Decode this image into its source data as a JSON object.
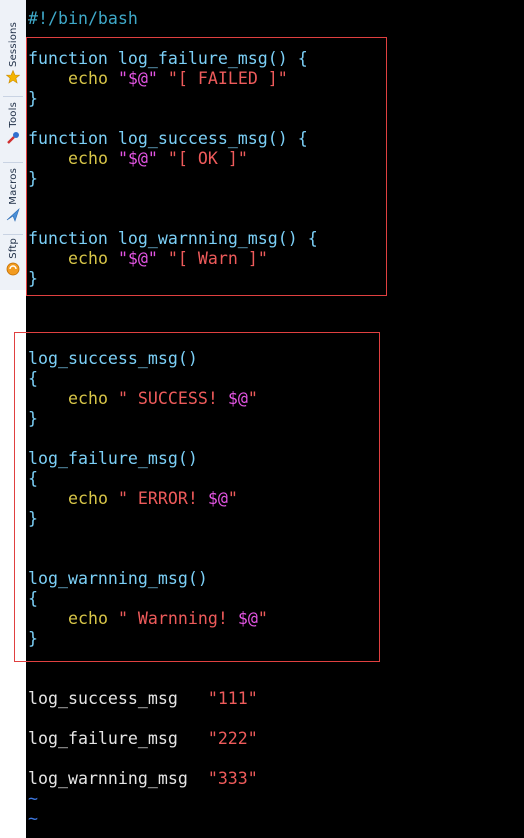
{
  "sidebar": {
    "tabs": [
      {
        "label": "Sessions",
        "icon": "sessions-icon"
      },
      {
        "label": "Tools",
        "icon": "star-icon"
      },
      {
        "label": "Macros",
        "icon": "macros-icon"
      },
      {
        "label": "Sftp",
        "icon": "sftp-icon"
      }
    ]
  },
  "editor": {
    "shebang": "#!/bin/bash",
    "block1": {
      "f1_kw": "function",
      "f1_name": " log_failure_msg() {",
      "f1_echo": "echo",
      "f1_str": "\"[ FAILED ]\"",
      "f2_kw": "function",
      "f2_name": " log_success_msg() {",
      "f2_echo": "echo",
      "f2_str": "\"[ OK ]\"",
      "f3_kw": "function",
      "f3_name": " log_warnning_msg() {",
      "f3_echo": "echo",
      "f3_str": "\"[ Warn ]\"",
      "close": "}",
      "var": "\"$@\""
    },
    "block2": {
      "g1_name": "log_success_msg()",
      "g1_open": "{",
      "g1_echo": "echo",
      "g1_q1": "\"",
      "g1_msg": " SUCCESS! ",
      "g1_var": "$@",
      "g1_q2": "\"",
      "g2_name": "log_failure_msg()",
      "g2_open": "{",
      "g2_echo": "echo",
      "g2_q1": "\"",
      "g2_msg": " ERROR! ",
      "g2_var": "$@",
      "g2_q2": "\"",
      "g3_name": "log_warnning_msg()",
      "g3_open": "{",
      "g3_echo": "echo",
      "g3_q1": "\"",
      "g3_msg": " Warnning! ",
      "g3_var": "$@",
      "g3_q2": "\"",
      "close": "}"
    },
    "calls": [
      {
        "cmd": "log_success_msg   ",
        "arg": "\"111\""
      },
      {
        "cmd": "log_failure_msg   ",
        "arg": "\"222\""
      },
      {
        "cmd": "log_warnning_msg  ",
        "arg": "\"333\""
      }
    ],
    "tilde": "~"
  },
  "colors": {
    "background": "#000000",
    "function_name": "#7cd0f7",
    "echo": "#d8c648",
    "string": "#ee5b5b",
    "variable": "#e455e4",
    "highlight_box": "#e04040"
  }
}
